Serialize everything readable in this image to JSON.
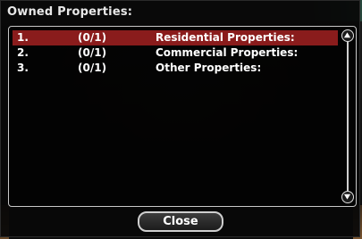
{
  "dialog": {
    "title": "Owned Properties:"
  },
  "list": {
    "rows": [
      {
        "number": "1.",
        "count": "(0/1)",
        "label": "Residential Properties:",
        "selected": true
      },
      {
        "number": "2.",
        "count": "(0/1)",
        "label": "Commercial Properties:",
        "selected": false
      },
      {
        "number": "3.",
        "count": "(0/1)",
        "label": "Other Properties:",
        "selected": false
      }
    ]
  },
  "scrollbar": {
    "up_icon": "arrow-up-icon",
    "down_icon": "arrow-down-icon"
  },
  "footer": {
    "close_label": "Close"
  },
  "colors": {
    "selected_row": "#8a1c1c",
    "text": "#ffffff",
    "border": "#c8c8c8"
  }
}
